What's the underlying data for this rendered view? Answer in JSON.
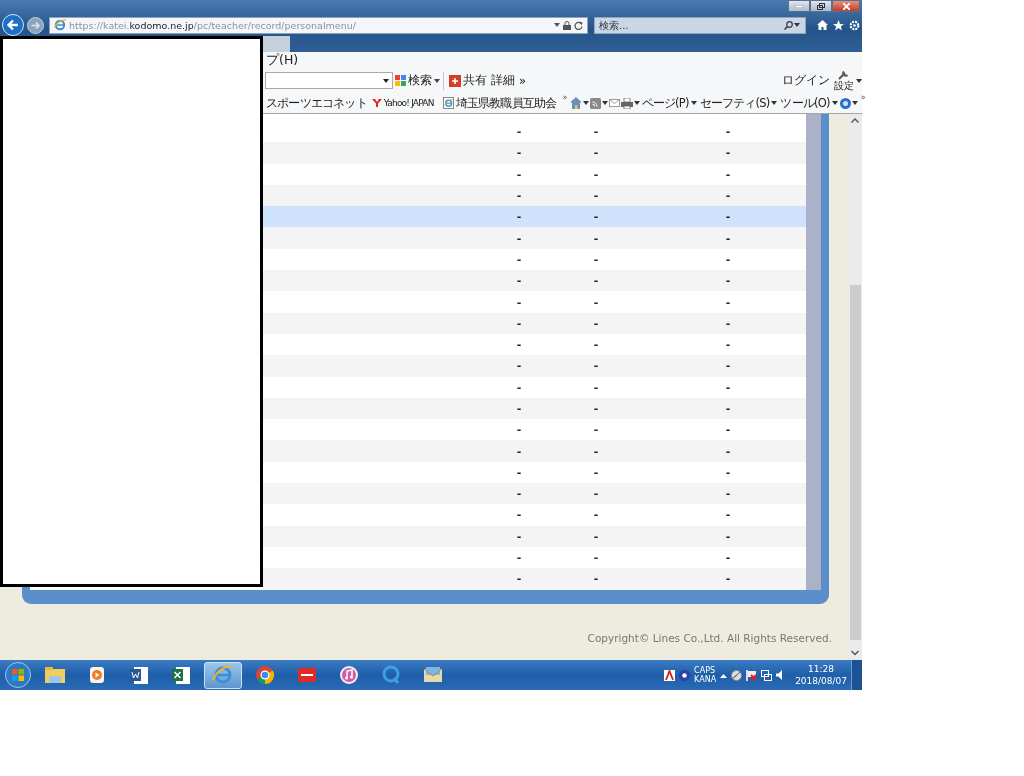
{
  "address_bar": {
    "url": "https://katei.**kodomo.ne.jp**/pc/teacher/record/personalmenu/"
  },
  "search_box": {
    "placeholder": "検索..."
  },
  "menu_bar": [
    {
      "label": "プ(H)"
    }
  ],
  "toolbar": {
    "search": "検索",
    "share": "共有",
    "details": "詳細",
    "more": "»",
    "login": "ログイン",
    "settings": "設定"
  },
  "favorites_bar": {
    "items": [
      {
        "kind": "site",
        "label": "スポーツエコネット"
      },
      {
        "kind": "yahoo",
        "label": "Yahoo! JAPAN"
      },
      {
        "kind": "page",
        "label": "埼玉県教職員互助会"
      }
    ],
    "more": "»"
  },
  "command_bar": {
    "menus": [
      "ページ(P)",
      "セーフティ(S)",
      "ツール(O)"
    ],
    "more": "»"
  },
  "table": {
    "rows": [
      {
        "cells": [
          "-",
          "-",
          "-"
        ],
        "selected": false
      },
      {
        "cells": [
          "-",
          "-",
          "-"
        ],
        "selected": false
      },
      {
        "cells": [
          "-",
          "-",
          "-"
        ],
        "selected": false
      },
      {
        "cells": [
          "-",
          "-",
          "-"
        ],
        "selected": false
      },
      {
        "cells": [
          "-",
          "-",
          "-"
        ],
        "selected": true
      },
      {
        "cells": [
          "-",
          "-",
          "-"
        ],
        "selected": false
      },
      {
        "cells": [
          "-",
          "-",
          "-"
        ],
        "selected": false
      },
      {
        "cells": [
          "-",
          "-",
          "-"
        ],
        "selected": false
      },
      {
        "cells": [
          "-",
          "-",
          "-"
        ],
        "selected": false
      },
      {
        "cells": [
          "-",
          "-",
          "-"
        ],
        "selected": false
      },
      {
        "cells": [
          "-",
          "-",
          "-"
        ],
        "selected": false
      },
      {
        "cells": [
          "-",
          "-",
          "-"
        ],
        "selected": false
      },
      {
        "cells": [
          "-",
          "-",
          "-"
        ],
        "selected": false
      },
      {
        "cells": [
          "-",
          "-",
          "-"
        ],
        "selected": false
      },
      {
        "cells": [
          "-",
          "-",
          "-"
        ],
        "selected": false
      },
      {
        "cells": [
          "-",
          "-",
          "-"
        ],
        "selected": false
      },
      {
        "cells": [
          "-",
          "-",
          "-"
        ],
        "selected": false
      },
      {
        "cells": [
          "-",
          "-",
          "-"
        ],
        "selected": false
      },
      {
        "cells": [
          "-",
          "-",
          "-"
        ],
        "selected": false
      },
      {
        "cells": [
          "-",
          "-",
          "-"
        ],
        "selected": false
      },
      {
        "cells": [
          "-",
          "-",
          "-"
        ],
        "selected": false
      },
      {
        "cells": [
          "-",
          "-",
          "-"
        ],
        "selected": false
      }
    ]
  },
  "footer": {
    "copyright": "Copyright© Lines Co.,Ltd. All Rights Reserved."
  },
  "taskbar": {
    "apps": [
      {
        "kind": "folder",
        "active": false
      },
      {
        "kind": "media",
        "active": false
      },
      {
        "kind": "word",
        "active": false
      },
      {
        "kind": "excel",
        "active": false
      },
      {
        "kind": "ie",
        "active": true
      },
      {
        "kind": "chrome",
        "active": false
      },
      {
        "kind": "red",
        "active": false
      },
      {
        "kind": "music",
        "active": false
      },
      {
        "kind": "quicktime",
        "active": false
      },
      {
        "kind": "mail",
        "active": false
      }
    ],
    "tray": {
      "caps": "CAPS",
      "kana": "KANA"
    },
    "clock": {
      "time": "11:28",
      "date": "2018/08/07"
    }
  }
}
